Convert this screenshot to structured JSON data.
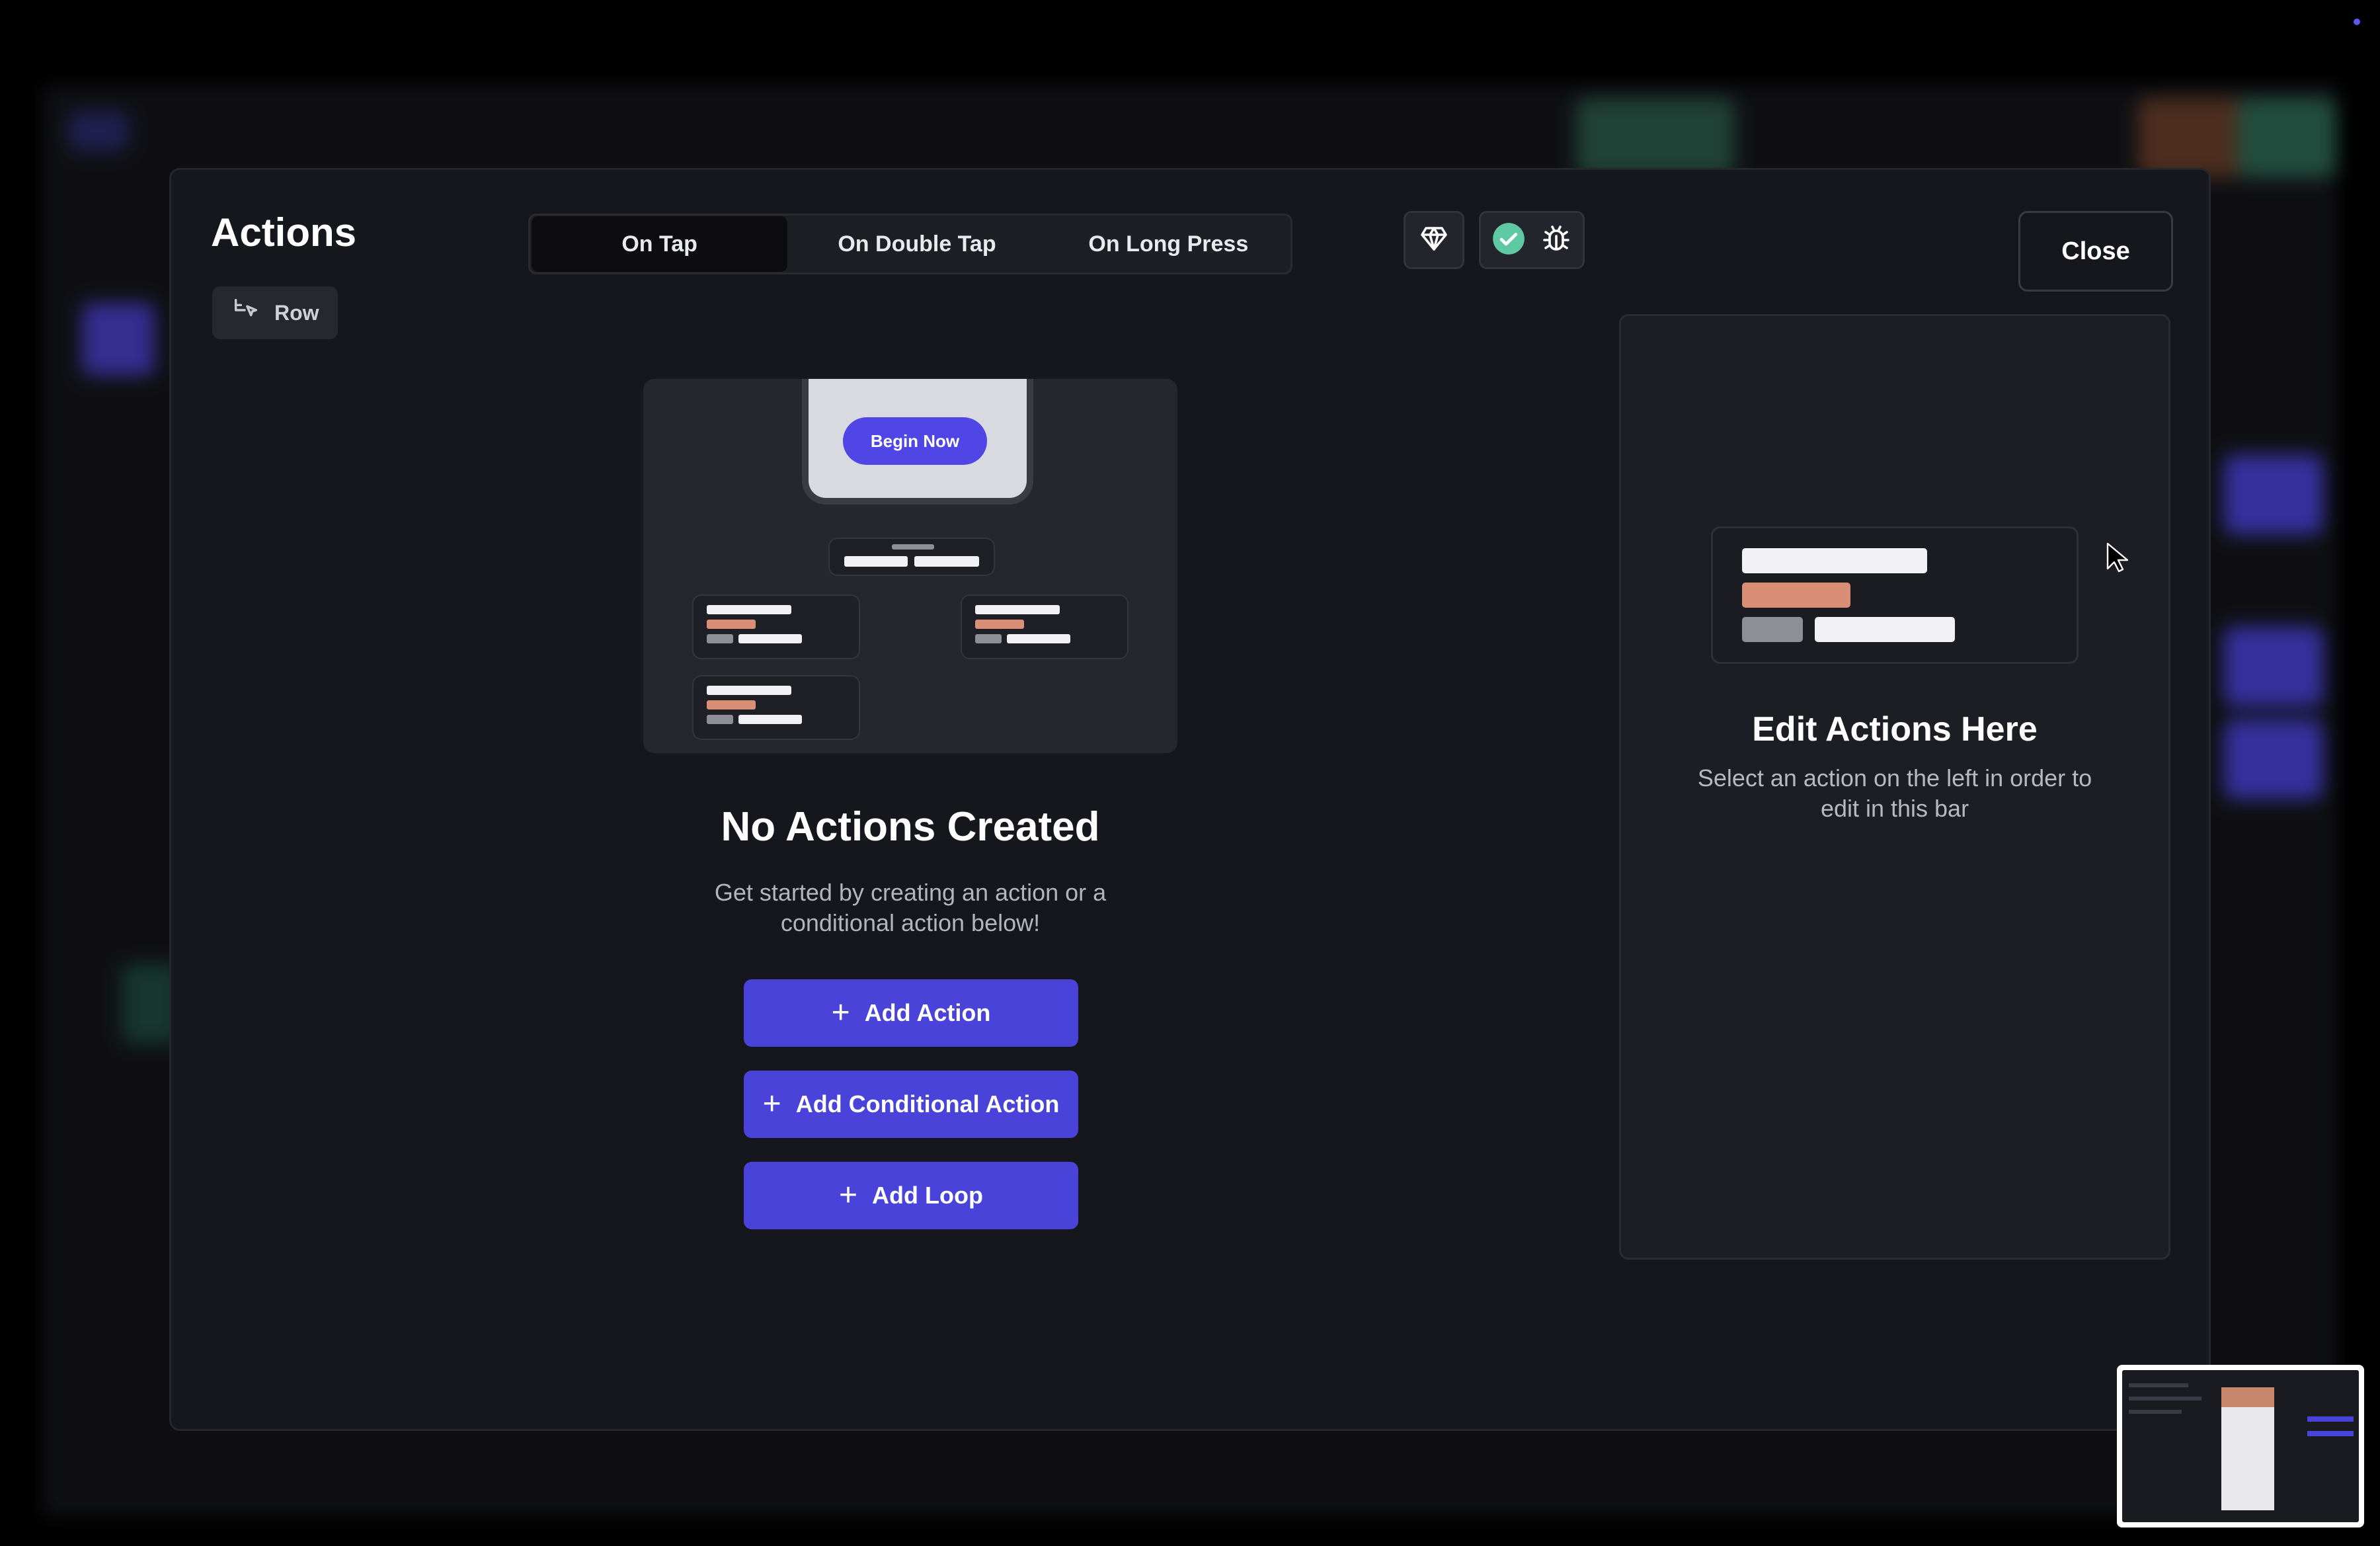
{
  "modal": {
    "title": "Actions",
    "widget_chip": "Row",
    "tabs": [
      {
        "label": "On Tap",
        "active": true
      },
      {
        "label": "On Double Tap",
        "active": false
      },
      {
        "label": "On Long Press",
        "active": false
      }
    ],
    "close_label": "Close"
  },
  "illustration": {
    "button_label": "Begin Now"
  },
  "empty_state": {
    "title": "No Actions Created",
    "subtitle": "Get started by creating an action or a conditional action below!"
  },
  "buttons": {
    "add_action": "Add Action",
    "add_conditional_action": "Add Conditional Action",
    "add_loop": "Add Loop"
  },
  "edit_panel": {
    "title": "Edit Actions Here",
    "subtitle": "Select an action on the left in order to edit in this bar"
  },
  "colors": {
    "accent": "#4a43d9",
    "check_green": "#5fc9a3",
    "illustration_orange": "#d88f76"
  },
  "icons": [
    "row-widget-icon",
    "gem-icon",
    "check-circle-icon",
    "bug-icon",
    "plus-icon",
    "cursor-icon"
  ]
}
